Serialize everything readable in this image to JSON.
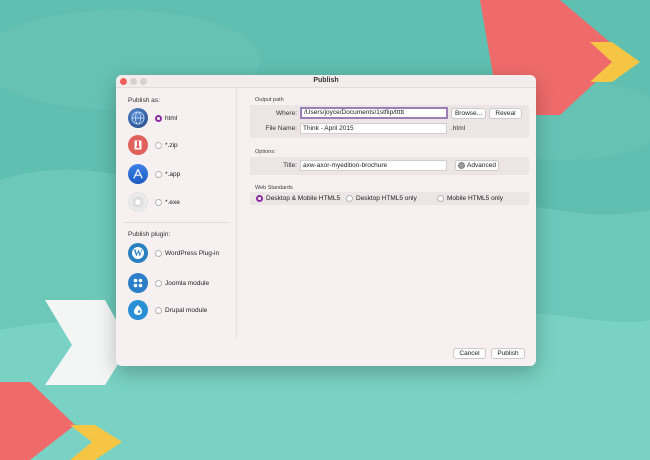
{
  "window": {
    "title": "Publish"
  },
  "publish_as": {
    "heading": "Publish as:",
    "options": [
      {
        "label": "html",
        "icon": "globe-icon",
        "selected": true
      },
      {
        "label": "*.zip",
        "icon": "zip-archive-icon",
        "selected": false
      },
      {
        "label": "*.app",
        "icon": "app-store-icon",
        "selected": false
      },
      {
        "label": "*.exe",
        "icon": "cd-disc-icon",
        "selected": false
      }
    ]
  },
  "publish_plugin": {
    "heading": "Publish plugin:",
    "options": [
      {
        "label": "WordPress Plug-in",
        "icon": "wordpress-icon",
        "selected": false
      },
      {
        "label": "Joomla module",
        "icon": "joomla-icon",
        "selected": false
      },
      {
        "label": "Drupal module",
        "icon": "drupal-icon",
        "selected": false
      }
    ]
  },
  "output_path": {
    "heading": "Output path",
    "where_label": "Where:",
    "where_value": "/Users/joyce/Documents/1stflip/ttttt",
    "browse_label": "Browse...",
    "reveal_label": "Reveal",
    "filename_label": "File Name:",
    "filename_value": "Think - April 2015",
    "extension": ".html"
  },
  "options": {
    "heading": "Options:",
    "title_label": "Title:",
    "title_value": "axw-axor-myedition-brochure",
    "advanced_label": "Advanced"
  },
  "web_standards": {
    "heading": "Web Standards",
    "options": [
      {
        "label": "Desktop & Mobile HTML5",
        "selected": true
      },
      {
        "label": "Desktop HTML5 only",
        "selected": false
      },
      {
        "label": "Mobile HTML5 only",
        "selected": false
      }
    ]
  },
  "footer": {
    "cancel_label": "Cancel",
    "publish_label": "Publish"
  },
  "colors": {
    "accent": "#8c2aa0",
    "background": "#5fbfb0",
    "arrow_red": "#ef6b6b",
    "arrow_yellow": "#f7c544"
  }
}
